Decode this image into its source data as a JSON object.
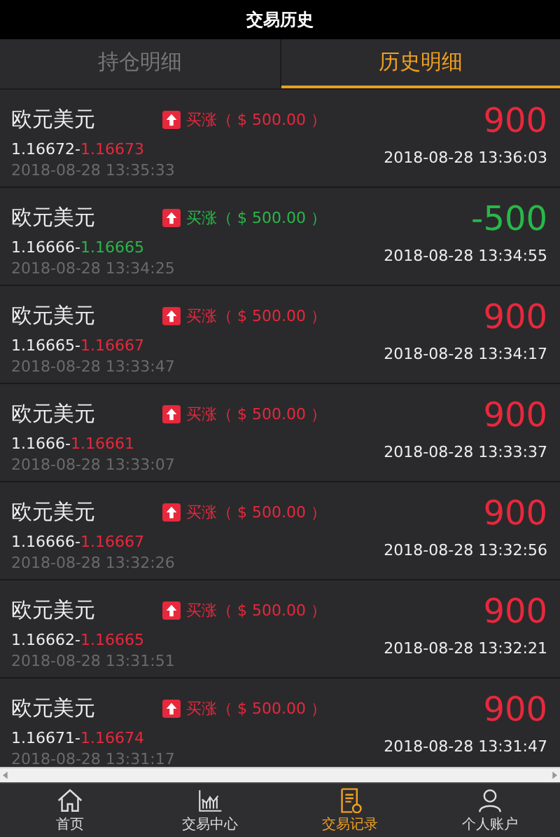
{
  "header": {
    "title": "交易历史"
  },
  "tabs": [
    {
      "label": "持仓明细",
      "selected": false
    },
    {
      "label": "历史明细",
      "selected": true
    }
  ],
  "trades": [
    {
      "pair": "欧元美元",
      "direction": "买涨（ $ 500.00 ）",
      "open_price": "1.16672-",
      "close_price": "1.16673",
      "open_time": "2018-08-28 13:35:33",
      "profit": "900",
      "close_time": "2018-08-28 13:36:03",
      "loss": false
    },
    {
      "pair": "欧元美元",
      "direction": "买涨（ $ 500.00 ）",
      "open_price": "1.16666-",
      "close_price": "1.16665",
      "open_time": "2018-08-28 13:34:25",
      "profit": "-500",
      "close_time": "2018-08-28 13:34:55",
      "loss": true
    },
    {
      "pair": "欧元美元",
      "direction": "买涨（ $ 500.00 ）",
      "open_price": "1.16665-",
      "close_price": "1.16667",
      "open_time": "2018-08-28 13:33:47",
      "profit": "900",
      "close_time": "2018-08-28 13:34:17",
      "loss": false
    },
    {
      "pair": "欧元美元",
      "direction": "买涨（ $ 500.00 ）",
      "open_price": "1.1666-",
      "close_price": "1.16661",
      "open_time": "2018-08-28 13:33:07",
      "profit": "900",
      "close_time": "2018-08-28 13:33:37",
      "loss": false
    },
    {
      "pair": "欧元美元",
      "direction": "买涨（ $ 500.00 ）",
      "open_price": "1.16666-",
      "close_price": "1.16667",
      "open_time": "2018-08-28 13:32:26",
      "profit": "900",
      "close_time": "2018-08-28 13:32:56",
      "loss": false
    },
    {
      "pair": "欧元美元",
      "direction": "买涨（ $ 500.00 ）",
      "open_price": "1.16662-",
      "close_price": "1.16665",
      "open_time": "2018-08-28 13:31:51",
      "profit": "900",
      "close_time": "2018-08-28 13:32:21",
      "loss": false
    },
    {
      "pair": "欧元美元",
      "direction": "买涨（ $ 500.00 ）",
      "open_price": "1.16671-",
      "close_price": "1.16674",
      "open_time": "2018-08-28 13:31:17",
      "profit": "900",
      "close_time": "2018-08-28 13:31:47",
      "loss": false
    }
  ],
  "nav": [
    {
      "label": "首页",
      "kind": "home",
      "selected": false
    },
    {
      "label": "交易中心",
      "kind": "chart",
      "selected": false
    },
    {
      "label": "交易记录",
      "kind": "record",
      "selected": true
    },
    {
      "label": "个人账户",
      "kind": "user",
      "selected": false
    }
  ]
}
